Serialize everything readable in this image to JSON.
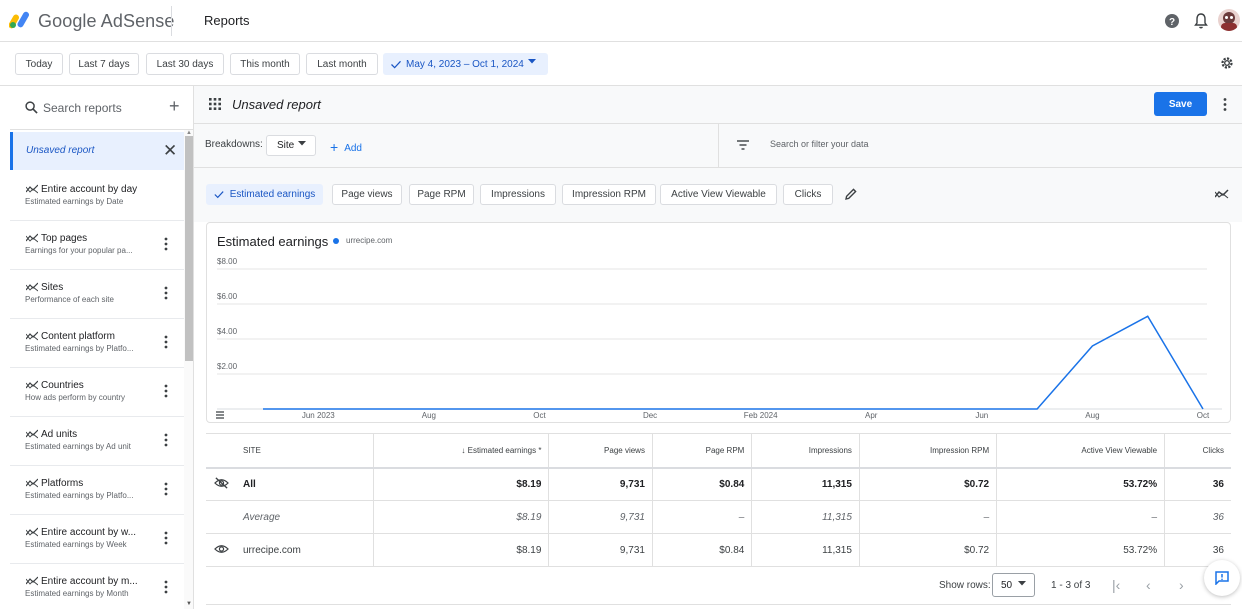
{
  "header": {
    "brand": "Google AdSense",
    "page_title": "Reports",
    "colors": {
      "brand_yellow": "#fbbc04",
      "brand_blue": "#4285f4",
      "brand_green": "#34a853"
    }
  },
  "date_filters": {
    "buttons": [
      "Today",
      "Last 7 days",
      "Last 30 days",
      "This month",
      "Last month"
    ],
    "selected_range": "May 4, 2023 – Oct 1, 2024"
  },
  "sidebar": {
    "search_placeholder": "Search reports",
    "active_report": "Unsaved report",
    "items": [
      {
        "name": "Entire account by day",
        "sub": "Estimated earnings by Date"
      },
      {
        "name": "Top pages",
        "sub": "Earnings for your popular pa..."
      },
      {
        "name": "Sites",
        "sub": "Performance of each site"
      },
      {
        "name": "Content platform",
        "sub": "Estimated earnings by Platfo..."
      },
      {
        "name": "Countries",
        "sub": "How ads perform by country"
      },
      {
        "name": "Ad units",
        "sub": "Estimated earnings by Ad unit"
      },
      {
        "name": "Platforms",
        "sub": "Estimated earnings by Platfo..."
      },
      {
        "name": "Entire account by w...",
        "sub": "Estimated earnings by Week"
      },
      {
        "name": "Entire account by m...",
        "sub": "Estimated earnings by Month"
      }
    ]
  },
  "report": {
    "title": "Unsaved report",
    "save_label": "Save",
    "breakdowns_label": "Breakdowns:",
    "breakdown_value": "Site",
    "add_label": "Add",
    "filter_placeholder": "Search or filter your data"
  },
  "metrics": [
    "Estimated earnings",
    "Page views",
    "Page RPM",
    "Impressions",
    "Impression RPM",
    "Active View Viewable",
    "Clicks"
  ],
  "chart_data": {
    "type": "line",
    "title": "Estimated earnings",
    "series": [
      {
        "name": "urrecipe.com",
        "color": "#1a73e8",
        "points": [
          [
            "2023-05",
            0
          ],
          [
            "2023-06",
            0
          ],
          [
            "2023-07",
            0
          ],
          [
            "2023-08",
            0
          ],
          [
            "2023-09",
            0
          ],
          [
            "2023-10",
            0
          ],
          [
            "2023-11",
            0
          ],
          [
            "2023-12",
            0
          ],
          [
            "2024-01",
            0
          ],
          [
            "2024-02",
            0
          ],
          [
            "2024-03",
            0
          ],
          [
            "2024-04",
            0
          ],
          [
            "2024-05",
            0
          ],
          [
            "2024-06",
            0
          ],
          [
            "2024-07",
            0
          ],
          [
            "2024-08",
            3.6
          ],
          [
            "2024-09",
            5.3
          ],
          [
            "2024-10",
            0
          ]
        ]
      }
    ],
    "yticks": [
      "$2.00",
      "$4.00",
      "$6.00",
      "$8.00"
    ],
    "ytick_values": [
      2,
      4,
      6,
      8
    ],
    "ylim": [
      0,
      8
    ],
    "xticks": [
      "Jun 2023",
      "Aug",
      "Oct",
      "Dec",
      "Feb 2024",
      "Apr",
      "Jun",
      "Aug",
      "Oct"
    ],
    "xtick_months": [
      "2023-06",
      "2023-08",
      "2023-10",
      "2023-12",
      "2024-02",
      "2024-04",
      "2024-06",
      "2024-08",
      "2024-10"
    ],
    "grid": true
  },
  "table": {
    "headers": [
      "SITE",
      "↓ Estimated earnings *",
      "Page views",
      "Page RPM",
      "Impressions",
      "Impression RPM",
      "Active View Viewable",
      "Clicks"
    ],
    "rows": [
      {
        "label": "All",
        "values": [
          "$8.19",
          "9,731",
          "$0.84",
          "11,315",
          "$0.72",
          "53.72%",
          "36"
        ]
      },
      {
        "label": "Average",
        "values": [
          "$8.19",
          "9,731",
          "–",
          "11,315",
          "–",
          "–",
          "36"
        ]
      },
      {
        "label": "urrecipe.com",
        "values": [
          "$8.19",
          "9,731",
          "$0.84",
          "11,315",
          "$0.72",
          "53.72%",
          "36"
        ]
      }
    ]
  },
  "pagination": {
    "show_rows_label": "Show rows:",
    "rows_value": "50",
    "range": "1 - 3 of 3"
  }
}
